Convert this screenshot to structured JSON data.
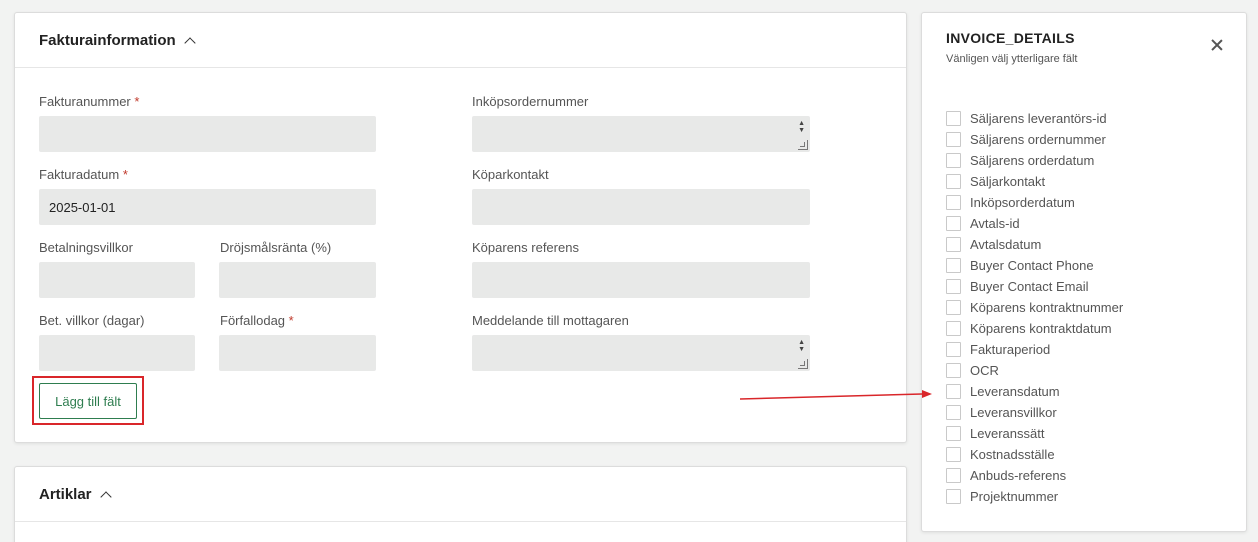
{
  "invoice_card": {
    "title": "Fakturainformation",
    "fields": {
      "invoice_number": {
        "label": "Fakturanummer",
        "value": ""
      },
      "purchase_order_number": {
        "label": "Inköpsordernummer",
        "value": ""
      },
      "invoice_date": {
        "label": "Fakturadatum",
        "value": "2025-01-01"
      },
      "buyer_contact": {
        "label": "Köparkontakt",
        "value": ""
      },
      "payment_terms": {
        "label": "Betalningsvillkor",
        "value": ""
      },
      "late_interest": {
        "label": "Dröjsmålsränta (%)",
        "value": ""
      },
      "buyer_reference": {
        "label": "Köparens referens",
        "value": ""
      },
      "payment_terms_days": {
        "label": "Bet. villkor (dagar)",
        "value": ""
      },
      "due_date": {
        "label": "Förfallodag",
        "value": ""
      },
      "message_to_recipient": {
        "label": "Meddelande till mottagaren",
        "value": ""
      }
    },
    "required_marker": "*",
    "add_field_button": "Lägg till fält"
  },
  "articles_card": {
    "title": "Artiklar"
  },
  "panel": {
    "title": "INVOICE_DETAILS",
    "subtitle": "Vänligen välj ytterligare fält",
    "options": [
      "Säljarens leverantörs-id",
      "Säljarens ordernummer",
      "Säljarens orderdatum",
      "Säljarkontakt",
      "Inköpsorderdatum",
      "Avtals-id",
      "Avtalsdatum",
      "Buyer Contact Phone",
      "Buyer Contact Email",
      "Köparens kontraktnummer",
      "Köparens kontraktdatum",
      "Fakturaperiod",
      "OCR",
      "Leveransdatum",
      "Leveransvillkor",
      "Leveranssätt",
      "Kostnadsställe",
      "Anbuds-referens",
      "Projektnummer"
    ]
  },
  "colors": {
    "accent_green": "#2e7d4f",
    "highlight_red": "#d9262a",
    "required_red": "#c0392b",
    "input_bg": "#e8e9e8"
  },
  "icons": [
    "chevron-up-icon",
    "close-icon",
    "spinner-icon",
    "resize-handle-icon",
    "annotation-arrow"
  ]
}
